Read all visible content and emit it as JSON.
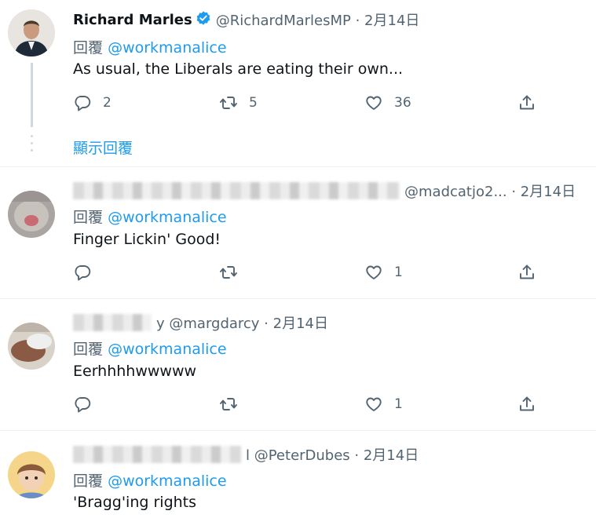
{
  "tweets": [
    {
      "name": "Richard Marles",
      "handle": "@RichardMarlesMP · 2月14日",
      "replying_label": "回覆",
      "mention": "@workmanalice",
      "text": "As usual, the Liberals are eating their own...",
      "reply_count": "2",
      "retweet_count": "5",
      "like_count": "36",
      "show_replies": "顯示回覆"
    },
    {
      "handle": "@madcatjo2... · 2月14日",
      "replying_label": "回覆",
      "mention": "@workmanalice",
      "text": "Finger Lickin' Good!",
      "reply_count": "",
      "retweet_count": "",
      "like_count": "1"
    },
    {
      "handle": "y @margdarcy · 2月14日",
      "replying_label": "回覆",
      "mention": "@workmanalice",
      "text": "Eerhhhhwwwww",
      "reply_count": "",
      "retweet_count": "",
      "like_count": "1"
    },
    {
      "handle": "l @PeterDubes · 2月14日",
      "replying_label": "回覆",
      "mention": "@workmanalice",
      "text": "'Bragg'ing rights"
    }
  ],
  "colors": {
    "link": "#1d9bf0",
    "secondary": "#536471",
    "primary": "#0f1419",
    "verified": "#1d9bf0"
  },
  "icons": [
    "reply-icon",
    "retweet-icon",
    "like-icon",
    "share-icon",
    "verified-badge-icon"
  ]
}
